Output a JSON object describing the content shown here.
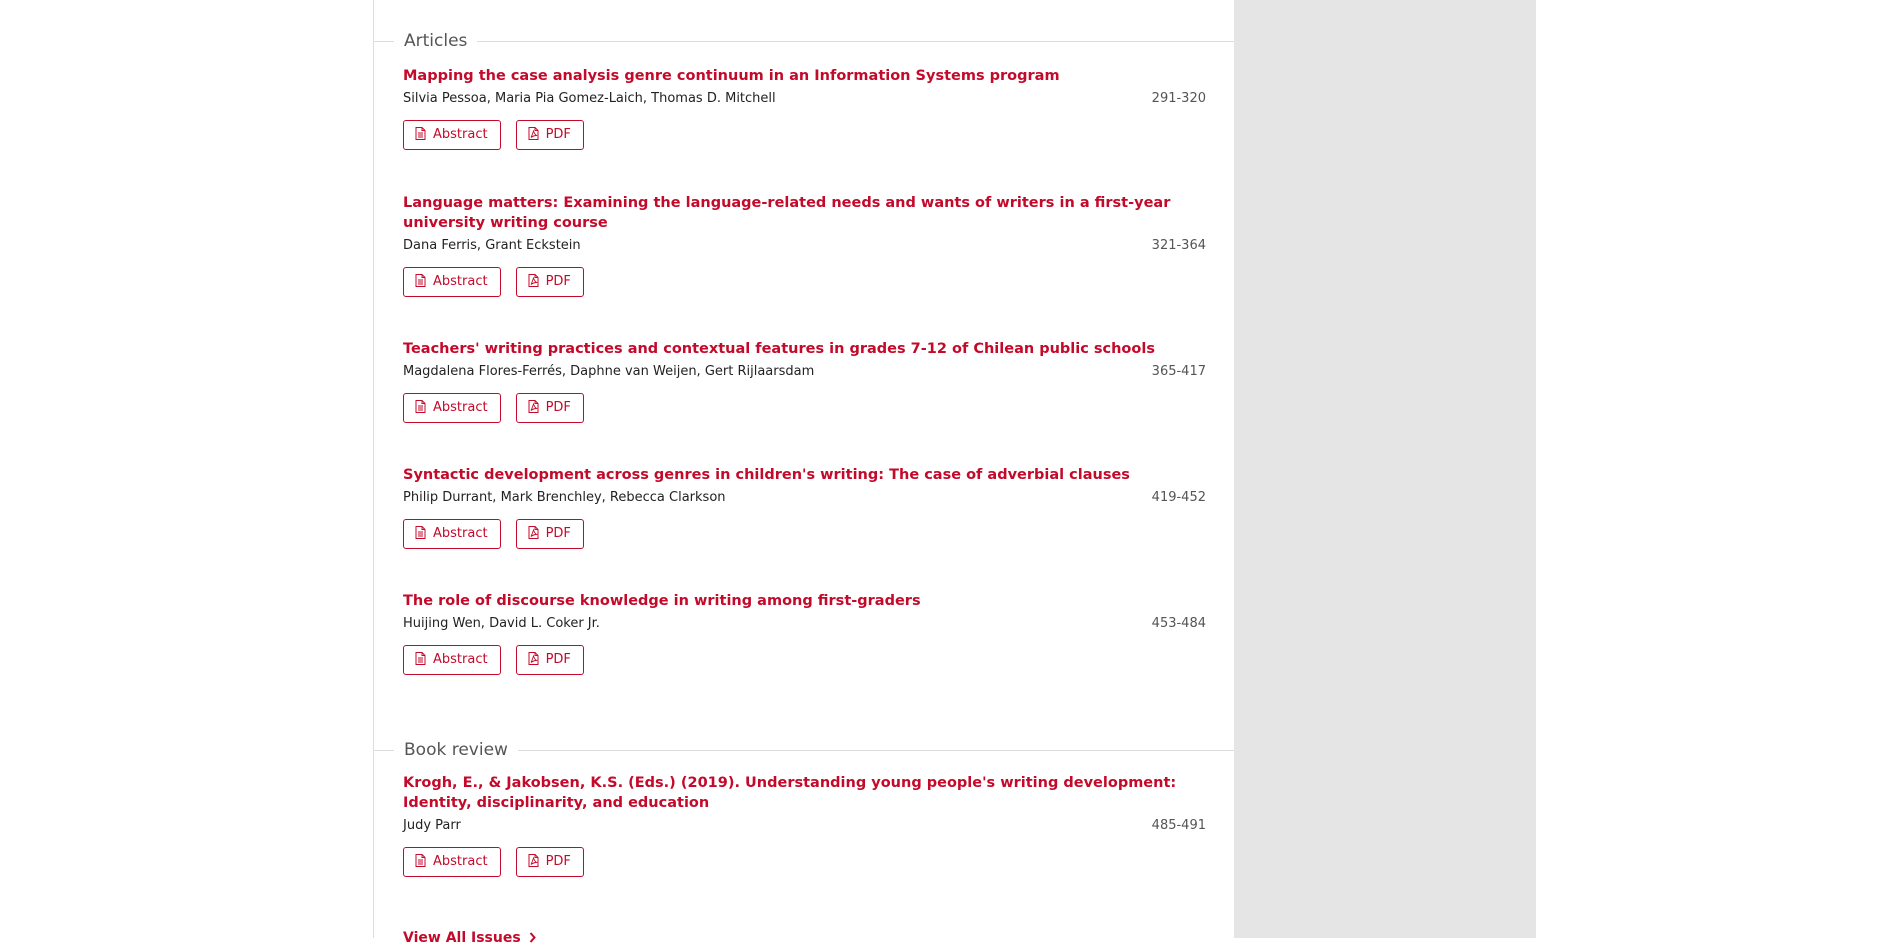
{
  "sections": [
    {
      "label": "Articles",
      "articles": [
        {
          "title": "Mapping the case analysis genre continuum in an Information Systems program",
          "authors": "Silvia Pessoa, Maria Pia Gomez-Laich, Thomas D. Mitchell",
          "pages": "291-320",
          "abstract_label": "Abstract",
          "pdf_label": "PDF"
        },
        {
          "title": "Language matters: Examining the language-related needs and wants of writers in a first-year university writing course",
          "authors": "Dana Ferris, Grant Eckstein",
          "pages": "321-364",
          "abstract_label": "Abstract",
          "pdf_label": "PDF"
        },
        {
          "title": "Teachers' writing practices and contextual features in grades 7-12 of Chilean public schools",
          "authors": "Magdalena Flores-Ferrés, Daphne van Weijen, Gert Rijlaarsdam",
          "pages": "365-417",
          "abstract_label": "Abstract",
          "pdf_label": "PDF"
        },
        {
          "title": "Syntactic development across genres in children's writing: The case of adverbial clauses",
          "authors": "Philip Durrant, Mark Brenchley, Rebecca Clarkson",
          "pages": "419-452",
          "abstract_label": "Abstract",
          "pdf_label": "PDF"
        },
        {
          "title": "The role of discourse knowledge in writing among first-graders",
          "authors": "Huijing Wen, David L. Coker Jr.",
          "pages": "453-484",
          "abstract_label": "Abstract",
          "pdf_label": "PDF"
        }
      ]
    },
    {
      "label": "Book review",
      "articles": [
        {
          "title": "Krogh, E., & Jakobsen, K.S. (Eds.) (2019). Understanding young people's writing development: Identity, disciplinarity, and education",
          "authors": "Judy Parr",
          "pages": "485-491",
          "abstract_label": "Abstract",
          "pdf_label": "PDF"
        }
      ]
    }
  ],
  "view_all_label": "View All Issues",
  "icons": {
    "abstract": "file-text-icon",
    "pdf": "file-pdf-icon",
    "view_all": "chevron-right-icon"
  },
  "colors": {
    "accent": "#c40a2b",
    "sidebar_bg": "#e5e5e5",
    "divider": "#dddddd"
  }
}
